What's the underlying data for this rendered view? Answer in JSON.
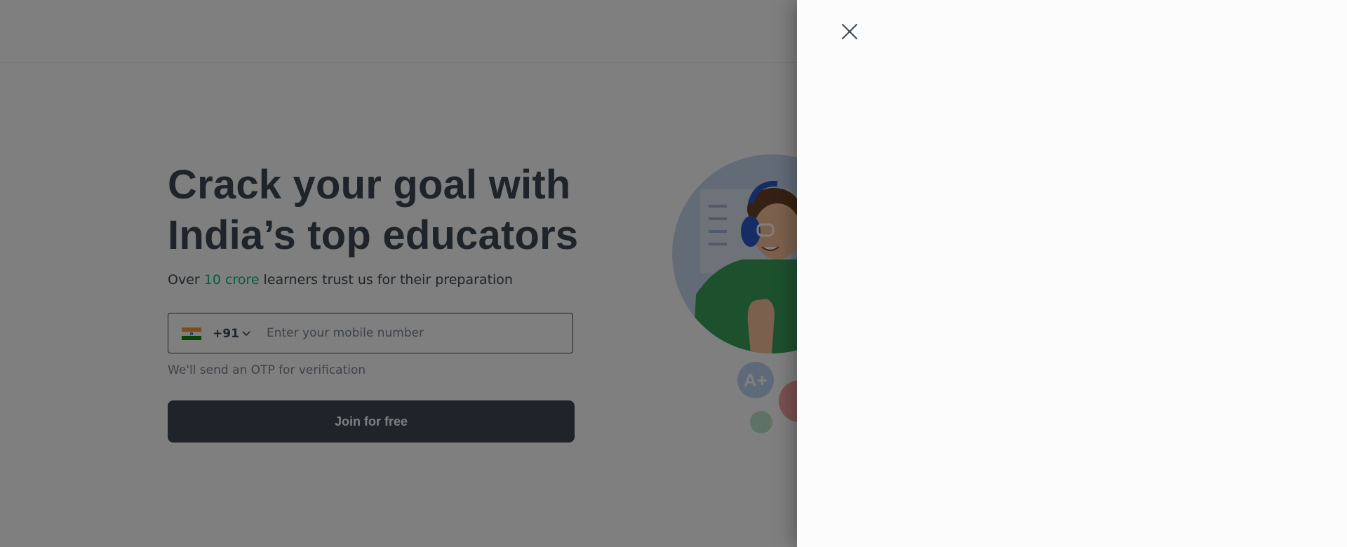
{
  "hero": {
    "title_line1": "Crack your goal with",
    "title_line2": "India’s top educators",
    "subtitle_before": "Over ",
    "subtitle_highlight": "10 crore",
    "subtitle_after": " learners trust us for their preparation"
  },
  "phone_form": {
    "country_code": "+91",
    "placeholder": "Enter your mobile number",
    "otp_note": "We'll send an OTP for verification",
    "join_label": "Join for free"
  },
  "illustration": {
    "badge_text": "A+"
  },
  "colors": {
    "accent": "#08bd80",
    "text": "#3c4852",
    "overlay": "rgba(0,0,0,0.5)",
    "drawer": "#fcfcfc"
  },
  "icons": {
    "close": "close-icon",
    "chevron": "chevron-down-icon",
    "flag": "india-flag-icon"
  }
}
